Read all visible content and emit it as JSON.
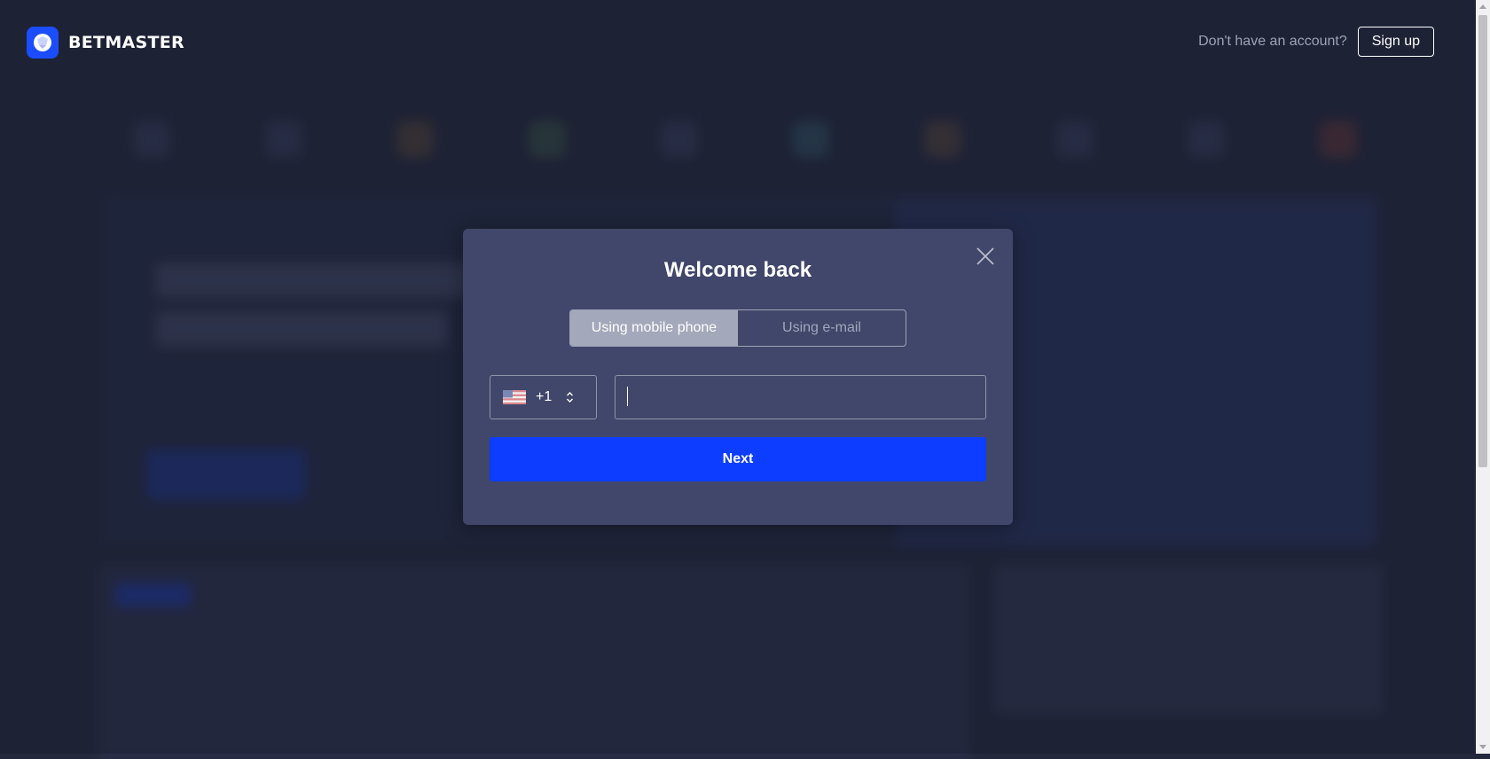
{
  "header": {
    "brand": "BETMASTER",
    "no_account_text": "Don't have an account?",
    "signup_label": "Sign up"
  },
  "modal": {
    "title": "Welcome back",
    "tabs": [
      {
        "label": "Using mobile phone",
        "active": true
      },
      {
        "label": "Using e-mail",
        "active": false
      }
    ],
    "country": {
      "flag": "us-flag-icon",
      "code": "+1"
    },
    "phone_value": "",
    "next_label": "Next"
  },
  "colors": {
    "background": "#23283c",
    "modal": "#41476a",
    "accent": "#0d3dff",
    "brand": "#1b4dff"
  }
}
